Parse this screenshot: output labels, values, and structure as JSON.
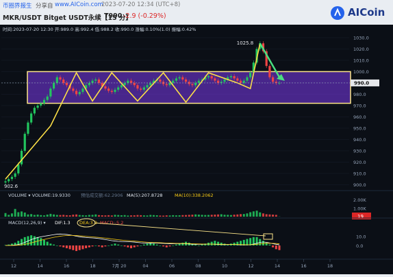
{
  "header": {
    "share_text": "币圈界报生",
    "share_from": "分享自",
    "share_url": "www.AICoin.com",
    "timestamp": "2023-07-20 12:34 (UTC+8)",
    "symbol": "MKR/USDT Bitget USDT永续【15 分】",
    "last": "T990",
    "change": "-2.9 (-0.29%)",
    "logo_text": "AICoin"
  },
  "ohlc_bar": {
    "text": "时间:2023-07-20 12:30  开:989.0  高:992.4  低:988.2  收:990.0  涨幅:0.10%(1.0)  振幅:0.42%"
  },
  "volume_bar": {
    "volume": "VOLUME ▾  VOLUME:19.9330",
    "amount": "预估成交额:62.2906",
    "ma5": "MA(5):207.8728",
    "ma10": "MA(10):338.2062"
  },
  "macd_bar": {
    "params": "MACD(12,26,9) ▾",
    "dif": "DIF:1.3",
    "dea": "DEA:3.9",
    "macd": "MACD:-5.2"
  },
  "colors": {
    "up": "#22c55e",
    "down": "#ef4444",
    "box_fill": "#7c3aed",
    "box_stroke": "#fde68a",
    "zigzag": "#fde047",
    "arrow": "#4ade80",
    "dif_line": "#ffffff",
    "dea_line": "#facc15"
  },
  "chart_data": {
    "type": "candlestick",
    "timeframe": "15m",
    "price_axis": {
      "ticks": [
        "1030.0",
        "1020.0",
        "1010.0",
        "1000.0",
        "990.0",
        "980.0",
        "970.0",
        "960.0",
        "950.0",
        "940.0",
        "930.0",
        "920.0",
        "910.0",
        "900.0"
      ],
      "range": [
        896,
        1033
      ],
      "current_label": "990.0"
    },
    "x_ticks": [
      "12",
      "14",
      "16",
      "18",
      "7月 20",
      "04",
      "06",
      "08",
      "10",
      "12",
      "14",
      "16",
      "18"
    ],
    "annotations": {
      "high_label": "1025.8",
      "low_label": "902.6",
      "consolidation_box": {
        "price_top": 1000,
        "price_bottom": 972
      },
      "zigzag_prices": [
        905,
        952,
        999,
        974,
        999,
        974,
        999,
        973,
        999,
        990,
        985,
        1025
      ],
      "arrow_prices": [
        1025,
        993
      ]
    },
    "price_approx": [
      903,
      905,
      907,
      910,
      918,
      930,
      945,
      955,
      963,
      968,
      970,
      972,
      975,
      978,
      985,
      990,
      995,
      993,
      990,
      988,
      985,
      983,
      980,
      982,
      985,
      988,
      990,
      992,
      993,
      990,
      987,
      985,
      983,
      982,
      984,
      986,
      988,
      990,
      992,
      990,
      988,
      985,
      984,
      986,
      988,
      990,
      992,
      993,
      991,
      989,
      988,
      990,
      992,
      994,
      995,
      993,
      991,
      989,
      988,
      990,
      992,
      993,
      995,
      996,
      994,
      992,
      990,
      991,
      993,
      995,
      996,
      994,
      992,
      990,
      992,
      995,
      999,
      1008,
      1020,
      1025,
      1018,
      1005,
      995,
      991,
      990,
      990
    ],
    "volume_axis": {
      "ticks": [
        "2.00K",
        "1.00K"
      ],
      "current_label": "19"
    },
    "volume_approx": [
      420,
      210,
      380,
      900,
      520,
      610,
      480,
      260,
      300,
      200,
      240,
      180,
      150,
      240,
      330,
      260,
      200,
      190,
      210,
      170,
      160,
      230,
      260,
      190,
      170,
      150,
      200,
      210,
      260,
      180,
      160,
      150,
      170,
      140,
      210,
      190,
      160,
      180,
      130,
      150,
      160,
      190,
      170,
      150,
      140,
      200,
      180,
      160,
      130,
      120,
      150,
      140,
      170,
      150,
      160,
      180,
      190,
      210,
      230,
      260,
      240,
      210,
      190,
      200,
      220,
      240,
      260,
      280,
      220,
      210,
      190,
      230,
      260,
      300,
      310,
      380,
      520,
      620,
      700,
      500,
      380,
      290,
      260,
      240,
      210,
      20
    ],
    "macd_axis": {
      "ticks": [
        "10.0",
        "0.0"
      ]
    },
    "macd_hist_approx": [
      0.5,
      1,
      2,
      3,
      5,
      7,
      9,
      10,
      11,
      10,
      9,
      8,
      6,
      4,
      2,
      1,
      0,
      -1,
      -2,
      -3,
      -4,
      -5,
      -6,
      -5,
      -4,
      -3,
      -2,
      -1,
      0,
      -1,
      -2,
      -1,
      0,
      1,
      2,
      1,
      0,
      -1,
      -2,
      -3,
      -2,
      -1,
      0,
      1,
      2,
      3,
      2,
      1,
      0,
      -1,
      -2,
      -1,
      0,
      1,
      2,
      3,
      4,
      3,
      2,
      1,
      0,
      1,
      2,
      3,
      4,
      5,
      4,
      3,
      2,
      1,
      2,
      3,
      4,
      5,
      6,
      7,
      8,
      9,
      9,
      7,
      5,
      3,
      1,
      -2,
      -4,
      -5
    ]
  }
}
